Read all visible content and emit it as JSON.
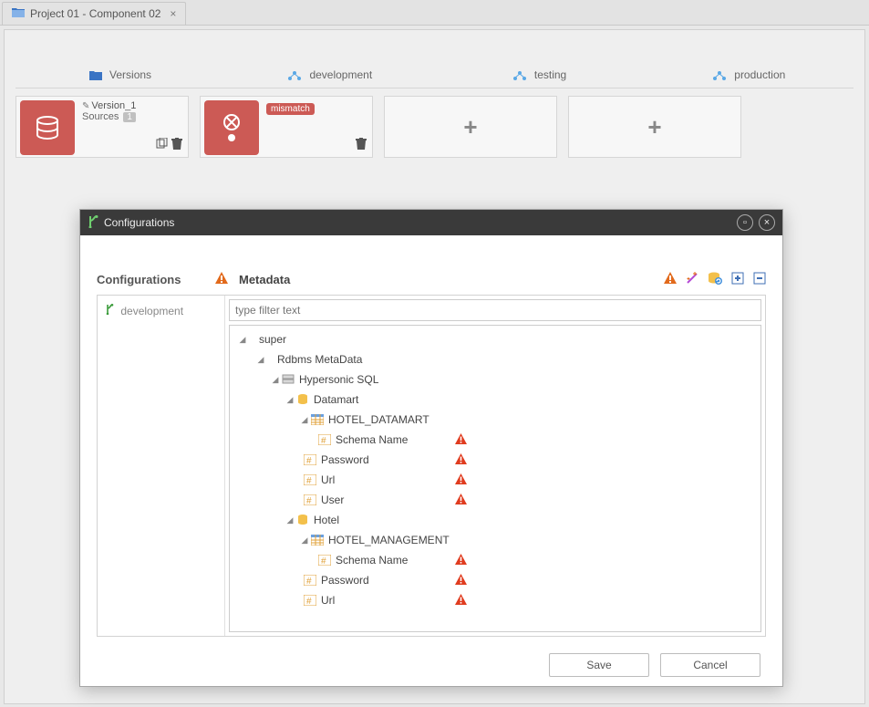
{
  "tab": {
    "title": "Project 01 - Component 02"
  },
  "pills": {
    "versions": "Versions",
    "development": "development",
    "testing": "testing",
    "production": "production"
  },
  "cards": {
    "version1": {
      "name": "Version_1",
      "sources_label": "Sources",
      "sources_count": "1"
    },
    "dev": {
      "badge": "mismatch"
    }
  },
  "modal": {
    "title": "Configurations",
    "left_header": "Configurations",
    "meta_header": "Metadata",
    "env": "development",
    "filter_placeholder": "type filter text",
    "save": "Save",
    "cancel": "Cancel"
  },
  "tree": {
    "n0": "super",
    "n1": "Rdbms MetaData",
    "n2": "Hypersonic SQL",
    "n3": "Datamart",
    "n4": "HOTEL_DATAMART",
    "n5": "Schema Name",
    "n6": "Password",
    "n7": "Url",
    "n8": "User",
    "n9": "Hotel",
    "n10": "HOTEL_MANAGEMENT",
    "n11": "Schema Name",
    "n12": "Password",
    "n13": "Url"
  }
}
